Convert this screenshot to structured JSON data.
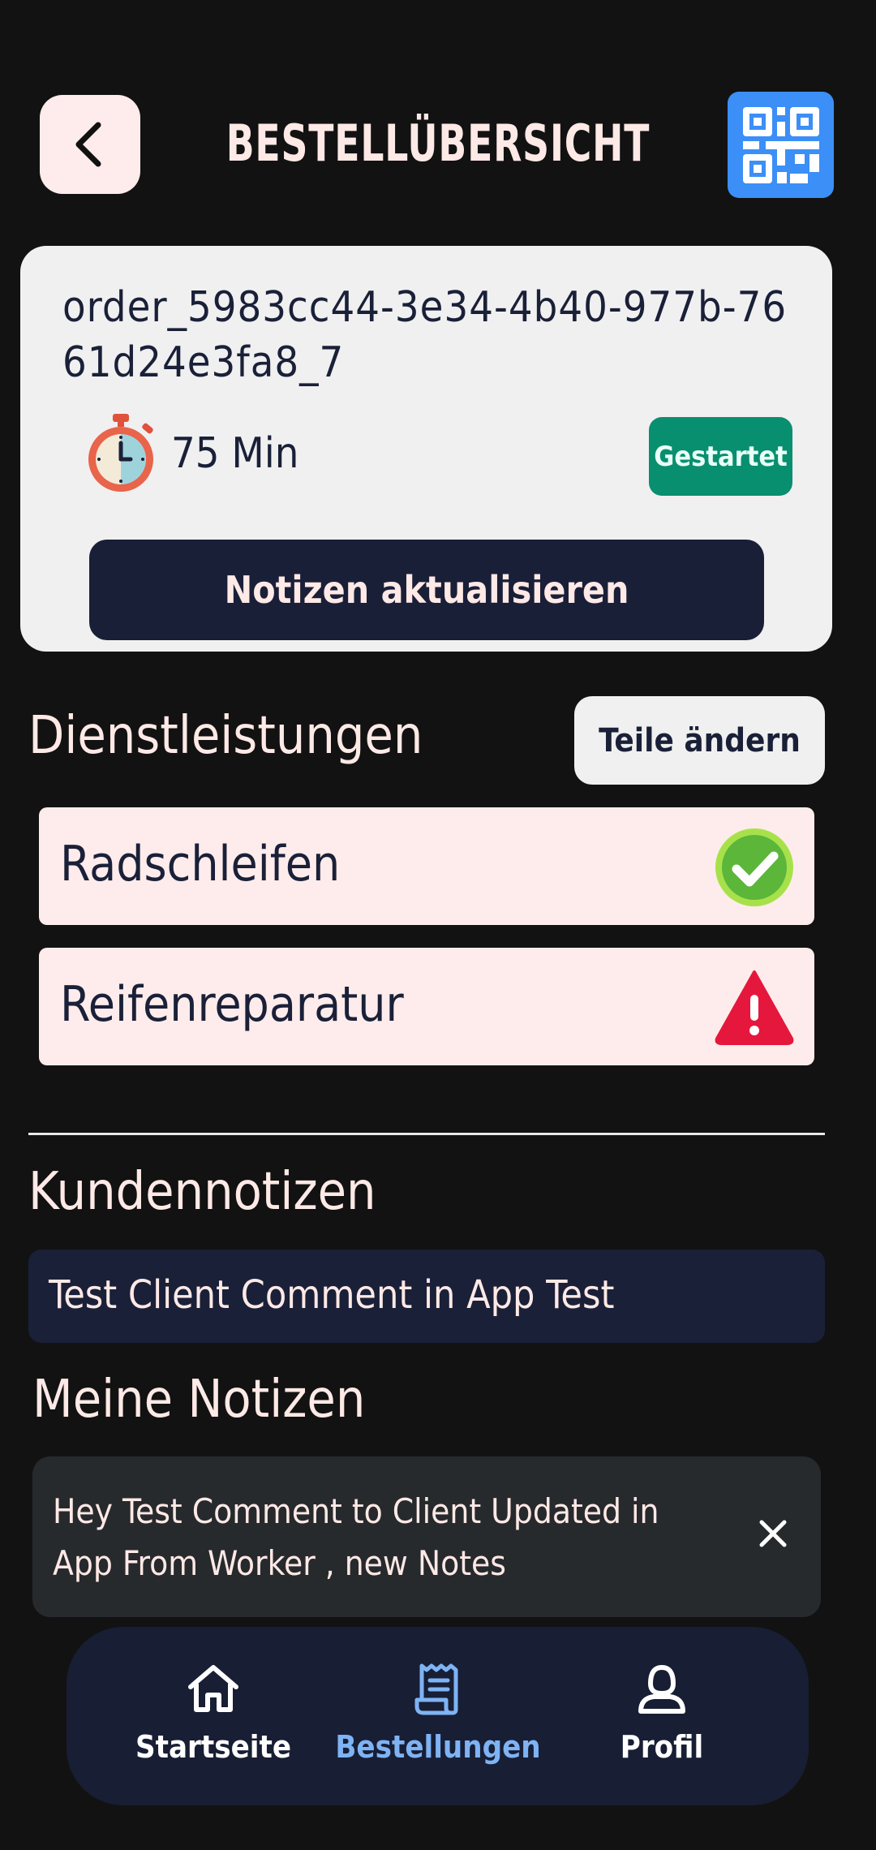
{
  "header": {
    "title": "BESTELLÜBERSICHT",
    "back_icon": "chevron-left-icon",
    "qr_icon": "qr-code-icon"
  },
  "order": {
    "id": "order_5983cc44-3e34-4b40-977b-7661d24e3fa8_7",
    "duration": "75 Min",
    "status": "Gestartet",
    "update_notes_label": "Notizen aktualisieren",
    "colors": {
      "status": "#088f6f",
      "primary": "#1a1f38"
    }
  },
  "services": {
    "title": "Dienstleistungen",
    "edit_label": "Teile ändern",
    "items": [
      {
        "label": "Radschleifen",
        "status_icon": "check-circle-icon"
      },
      {
        "label": "Reifenreparatur",
        "status_icon": "warning-icon"
      }
    ]
  },
  "client_notes": {
    "title": "Kundennotizen",
    "text": "Test Client Comment in App Test"
  },
  "my_notes": {
    "title": "Meine Notizen",
    "items": [
      {
        "text": "Hey Test Comment to Client Updated in App From Worker , new Notes"
      }
    ]
  },
  "nav": {
    "items": [
      {
        "label": "Startseite",
        "icon": "home-icon",
        "active": false
      },
      {
        "label": "Bestellungen",
        "icon": "receipt-icon",
        "active": true
      },
      {
        "label": "Profil",
        "icon": "user-icon",
        "active": false
      }
    ],
    "colors": {
      "active": "#7eb3f4",
      "inactive": "#ffffff"
    }
  }
}
